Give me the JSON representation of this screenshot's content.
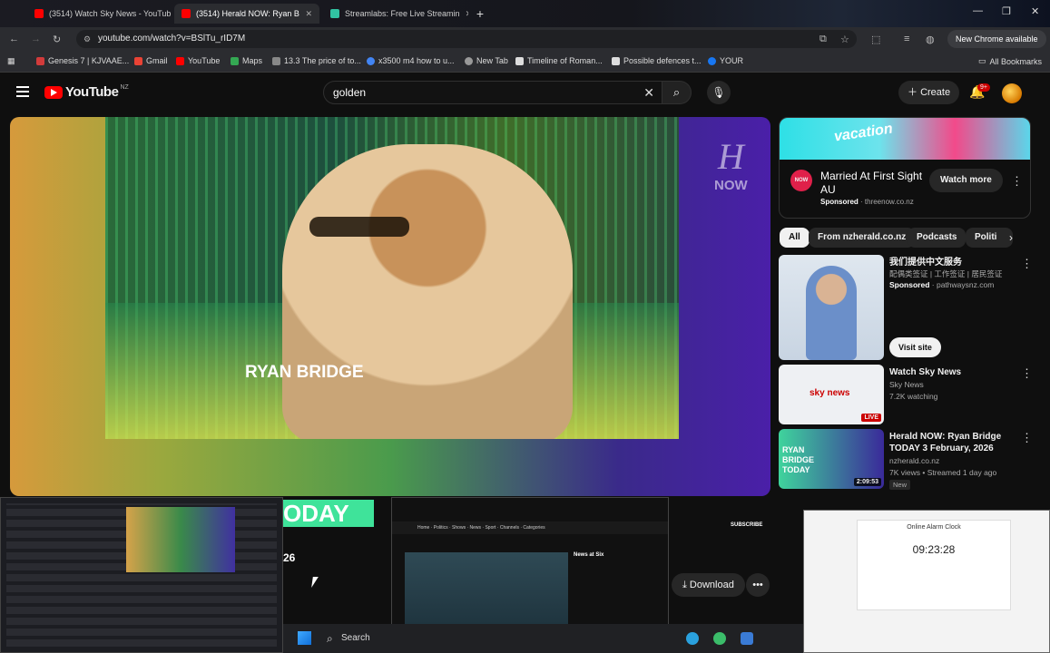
{
  "browser": {
    "tabs": [
      {
        "title": "(3514) Watch Sky News - YouTub",
        "active": false
      },
      {
        "title": "(3514) Herald NOW: Ryan B",
        "active": true
      },
      {
        "title": "Streamlabs: Free Live Streamin",
        "active": false
      }
    ],
    "url": "youtube.com/watch?v=BSlTu_rID7M",
    "new_chrome_label": "New Chrome available",
    "bookmarks": [
      {
        "label": "Genesis 7 | KJVAAE...",
        "color": "#d23b3b"
      },
      {
        "label": "Gmail",
        "color": "#ea4335"
      },
      {
        "label": "YouTube",
        "color": "#ff0000"
      },
      {
        "label": "Maps",
        "color": "#34a853"
      },
      {
        "label": "13.3 The price of to...",
        "color": "#888888"
      },
      {
        "label": "x3500 m4 how to u...",
        "color": "#4285f4"
      },
      {
        "label": "New Tab",
        "color": "#999999"
      },
      {
        "label": "Timeline of Roman...",
        "color": "#dddddd"
      },
      {
        "label": "Possible defences t...",
        "color": "#dddddd"
      },
      {
        "label": "YOUR",
        "color": "#1877f2"
      }
    ],
    "all_bookmarks_label": "All Bookmarks"
  },
  "youtube": {
    "logo_text": "YouTube",
    "region": "NZ",
    "search_value": "golden",
    "create_label": "Create",
    "notif_count": "9+",
    "video": {
      "channel_logo": "NOW",
      "show_line1": "RYAN BRIDGE",
      "show_line2": "ODAY",
      "side_text": "26",
      "subscribe_text": "SUBSCRIBE"
    },
    "actions": {
      "download_label": "Download"
    },
    "ad": {
      "banner_text": "vacation",
      "logo_text": "NOW",
      "title": "Married At First Sight AU",
      "sponsored": "Sponsored",
      "domain": "threenow.co.nz",
      "cta": "Watch more"
    },
    "chips": [
      "All",
      "From nzherald.co.nz",
      "Podcasts",
      "Politi"
    ],
    "recs": [
      {
        "title": "我们提供中文服务",
        "subtitle": "配偶类签证 | 工作签证 | 居民签证",
        "sponsored": "Sponsored",
        "domain": "pathwaysnz.com",
        "cta": "Visit site"
      },
      {
        "title": "Watch Sky News",
        "channel": "Sky News",
        "meta": "7.2K watching",
        "badge": "LIVE",
        "thumb_text": "sky news"
      },
      {
        "title": "Herald NOW: Ryan Bridge TODAY 3 February, 2026",
        "channel": "nzherald.co.nz",
        "meta": "7K views • Streamed 1 day ago",
        "duration": "2:09:53",
        "new_label": "New",
        "thumb_text": "RYAN BRIDGE TODAY"
      }
    ]
  },
  "overlays": {
    "news_window_title": "News at Six",
    "clock_title": "Online Alarm Clock",
    "clock_time": "09:23:28"
  },
  "taskbar": {
    "search_label": "Search"
  }
}
